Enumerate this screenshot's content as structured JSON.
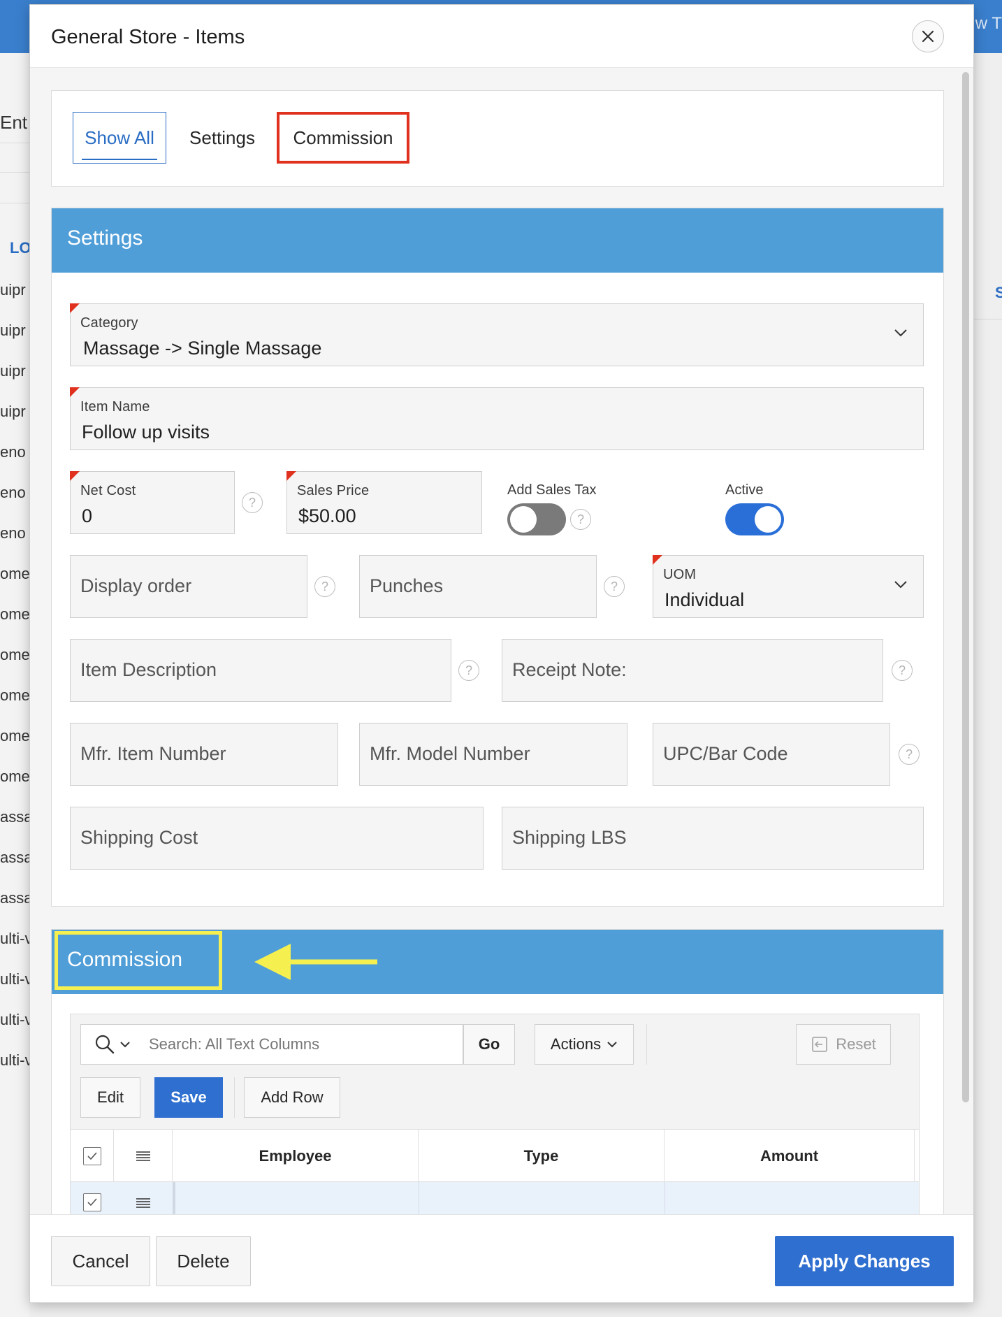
{
  "background": {
    "topbar_fragment": "w T",
    "left_fragments": [
      "Ent",
      "LO",
      "uipr",
      "uipr",
      "uipr",
      "uipr",
      "eno",
      "eno",
      "eno",
      "ome",
      "ome",
      "ome",
      "ome",
      "ome",
      "ome",
      "assa",
      "assa",
      "assa",
      "ulti-v",
      "ulti-v",
      "ulti-v",
      "ulti-v"
    ],
    "right_fragment": "S"
  },
  "modal": {
    "title": "General Store - Items",
    "close_label": "×"
  },
  "tabs": [
    {
      "label": "Show All",
      "active": true
    },
    {
      "label": "Settings",
      "active": false
    },
    {
      "label": "Commission",
      "active": false,
      "highlighted": true
    }
  ],
  "settings": {
    "title": "Settings",
    "category": {
      "label": "Category",
      "value": "Massage -> Single Massage",
      "required": true
    },
    "item_name": {
      "label": "Item Name",
      "value": "Follow up visits",
      "required": true
    },
    "net_cost": {
      "label": "Net Cost",
      "value": "0",
      "required": true
    },
    "sales_price": {
      "label": "Sales Price",
      "value": "$50.00",
      "required": true
    },
    "add_sales_tax": {
      "label": "Add Sales Tax",
      "on": false
    },
    "active": {
      "label": "Active",
      "on": true
    },
    "display_order": {
      "placeholder": "Display order"
    },
    "punches": {
      "placeholder": "Punches"
    },
    "uom": {
      "label": "UOM",
      "value": "Individual",
      "required": true
    },
    "item_description": {
      "placeholder": "Item Description"
    },
    "receipt_note": {
      "placeholder": "Receipt Note:"
    },
    "mfr_item_number": {
      "placeholder": "Mfr. Item Number"
    },
    "mfr_model_number": {
      "placeholder": "Mfr. Model Number"
    },
    "upc": {
      "placeholder": "UPC/Bar Code"
    },
    "shipping_cost": {
      "placeholder": "Shipping Cost"
    },
    "shipping_lbs": {
      "placeholder": "Shipping LBS"
    },
    "help_glyph": "?"
  },
  "commission": {
    "title": "Commission",
    "search_placeholder": "Search: All Text Columns",
    "go_label": "Go",
    "actions_label": "Actions",
    "reset_label": "Reset",
    "edit_label": "Edit",
    "save_label": "Save",
    "add_row_label": "Add Row",
    "columns": [
      "Employee",
      "Type",
      "Amount"
    ]
  },
  "footer": {
    "cancel_label": "Cancel",
    "delete_label": "Delete",
    "apply_label": "Apply Changes"
  },
  "colors": {
    "region_header": "#4f9ed8",
    "primary_button": "#2f6fd0",
    "highlight_red": "#e0301e",
    "highlight_yellow": "#f5f050",
    "required_marker": "#e0301e"
  }
}
